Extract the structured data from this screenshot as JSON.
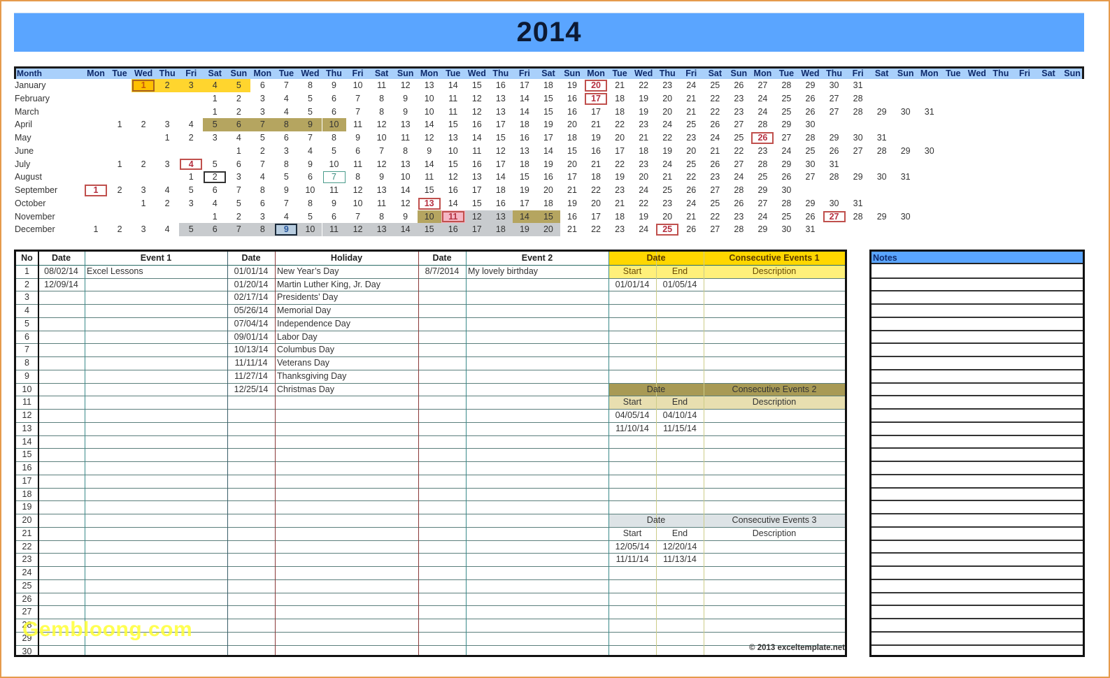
{
  "title": "2014",
  "calendar": {
    "month_header": "Month",
    "day_headers": [
      "Mon",
      "Tue",
      "Wed",
      "Thu",
      "Fri",
      "Sat",
      "Sun",
      "Mon",
      "Tue",
      "Wed",
      "Thu",
      "Fri",
      "Sat",
      "Sun",
      "Mon",
      "Tue",
      "Wed",
      "Thu",
      "Fri",
      "Sat",
      "Sun",
      "Mon",
      "Tue",
      "Wed",
      "Thu",
      "Fri",
      "Sat",
      "Sun",
      "Mon",
      "Tue",
      "Wed",
      "Thu",
      "Fri",
      "Sat",
      "Sun",
      "Mon",
      "Tue",
      "Wed",
      "Thu",
      "Fri",
      "Sat",
      "Sun"
    ],
    "months": [
      {
        "name": "January",
        "offset": 2,
        "days": 31
      },
      {
        "name": "February",
        "offset": 5,
        "days": 28
      },
      {
        "name": "March",
        "offset": 5,
        "days": 31
      },
      {
        "name": "April",
        "offset": 1,
        "days": 30
      },
      {
        "name": "May",
        "offset": 3,
        "days": 31
      },
      {
        "name": "June",
        "offset": 6,
        "days": 30
      },
      {
        "name": "July",
        "offset": 1,
        "days": 31
      },
      {
        "name": "August",
        "offset": 4,
        "days": 31
      },
      {
        "name": "September",
        "offset": 0,
        "days": 30
      },
      {
        "name": "October",
        "offset": 2,
        "days": 31
      },
      {
        "name": "November",
        "offset": 5,
        "days": 30
      },
      {
        "name": "December",
        "offset": 0,
        "days": 31
      }
    ],
    "highlights": [
      {
        "month": 1,
        "from": 1,
        "to": 5,
        "style": "yellow"
      },
      {
        "month": 4,
        "from": 5,
        "to": 10,
        "style": "olive"
      },
      {
        "month": 11,
        "from": 10,
        "to": 10,
        "style": "olive"
      },
      {
        "month": 11,
        "from": 11,
        "to": 11,
        "style": "pink"
      },
      {
        "month": 11,
        "from": 12,
        "to": 13,
        "style": "grey"
      },
      {
        "month": 11,
        "from": 14,
        "to": 15,
        "style": "olive"
      },
      {
        "month": 12,
        "from": 5,
        "to": 20,
        "style": "grey"
      }
    ],
    "marked_days": [
      {
        "month": 1,
        "day": 1,
        "kind": "orange"
      },
      {
        "month": 1,
        "day": 20,
        "kind": "red"
      },
      {
        "month": 2,
        "day": 17,
        "kind": "red"
      },
      {
        "month": 5,
        "day": 26,
        "kind": "red"
      },
      {
        "month": 7,
        "day": 4,
        "kind": "red"
      },
      {
        "month": 8,
        "day": 2,
        "kind": "black"
      },
      {
        "month": 8,
        "day": 7,
        "kind": "teal"
      },
      {
        "month": 9,
        "day": 1,
        "kind": "red"
      },
      {
        "month": 10,
        "day": 13,
        "kind": "red"
      },
      {
        "month": 11,
        "day": 11,
        "kind": "red"
      },
      {
        "month": 11,
        "day": 27,
        "kind": "red"
      },
      {
        "month": 12,
        "day": 9,
        "kind": "navy"
      },
      {
        "month": 12,
        "day": 25,
        "kind": "red"
      }
    ]
  },
  "table": {
    "headers": {
      "no": "No",
      "date1": "Date",
      "event1": "Event 1",
      "date2": "Date",
      "holiday": "Holiday",
      "date3": "Date",
      "event2": "Event 2",
      "ce_date": "Date",
      "ce1_title": "Consecutive Events 1",
      "start": "Start",
      "end": "End",
      "description": "Description",
      "ce2_title": "Consecutive Events 2",
      "ce3_title": "Consecutive Events 3"
    },
    "row_numbers": [
      "1",
      "2",
      "3",
      "4",
      "5",
      "6",
      "7",
      "8",
      "9",
      "10",
      "11",
      "12",
      "13",
      "14",
      "15",
      "16",
      "17",
      "18",
      "19",
      "20",
      "21",
      "22",
      "23",
      "24",
      "25",
      "26",
      "27",
      "28",
      "29",
      "30"
    ],
    "events1": [
      {
        "date": "08/02/14",
        "event": "Excel Lessons"
      },
      {
        "date": "12/09/14",
        "event": ""
      }
    ],
    "holidays": [
      {
        "date": "01/01/14",
        "name": "New Year’s Day"
      },
      {
        "date": "01/20/14",
        "name": "Martin Luther King, Jr. Day"
      },
      {
        "date": "02/17/14",
        "name": "Presidents’ Day"
      },
      {
        "date": "05/26/14",
        "name": "Memorial Day"
      },
      {
        "date": "07/04/14",
        "name": "Independence Day"
      },
      {
        "date": "09/01/14",
        "name": "Labor Day"
      },
      {
        "date": "10/13/14",
        "name": "Columbus Day"
      },
      {
        "date": "11/11/14",
        "name": "Veterans Day"
      },
      {
        "date": "11/27/14",
        "name": "Thanksgiving Day"
      },
      {
        "date": "12/25/14",
        "name": "Christmas Day"
      }
    ],
    "events2": [
      {
        "date": "8/7/2014",
        "event": "My lovely birthday"
      }
    ],
    "consecutive1": [
      {
        "start": "01/01/14",
        "end": "01/05/14",
        "description": ""
      }
    ],
    "consecutive2": [
      {
        "start": "04/05/14",
        "end": "04/10/14",
        "description": ""
      },
      {
        "start": "11/10/14",
        "end": "11/15/14",
        "description": ""
      }
    ],
    "consecutive3": [
      {
        "start": "12/05/14",
        "end": "12/20/14",
        "description": ""
      },
      {
        "start": "11/11/14",
        "end": "11/13/14",
        "description": ""
      }
    ]
  },
  "notes": {
    "header": "Notes"
  },
  "copyright": "© 2013 exceltemplate.net",
  "watermark": "Gembloong.com",
  "colors": {
    "title_bar": "#5aa5ff",
    "header_row": "#a9d0fb",
    "ce1_header": "#ffd700",
    "ce1_subheader": "#fff07a",
    "ce2_header": "#a89a55",
    "ce2_subheader": "#e8dfb0",
    "ce3_header": "#dde3e6",
    "holiday_mark": "#b53040"
  }
}
